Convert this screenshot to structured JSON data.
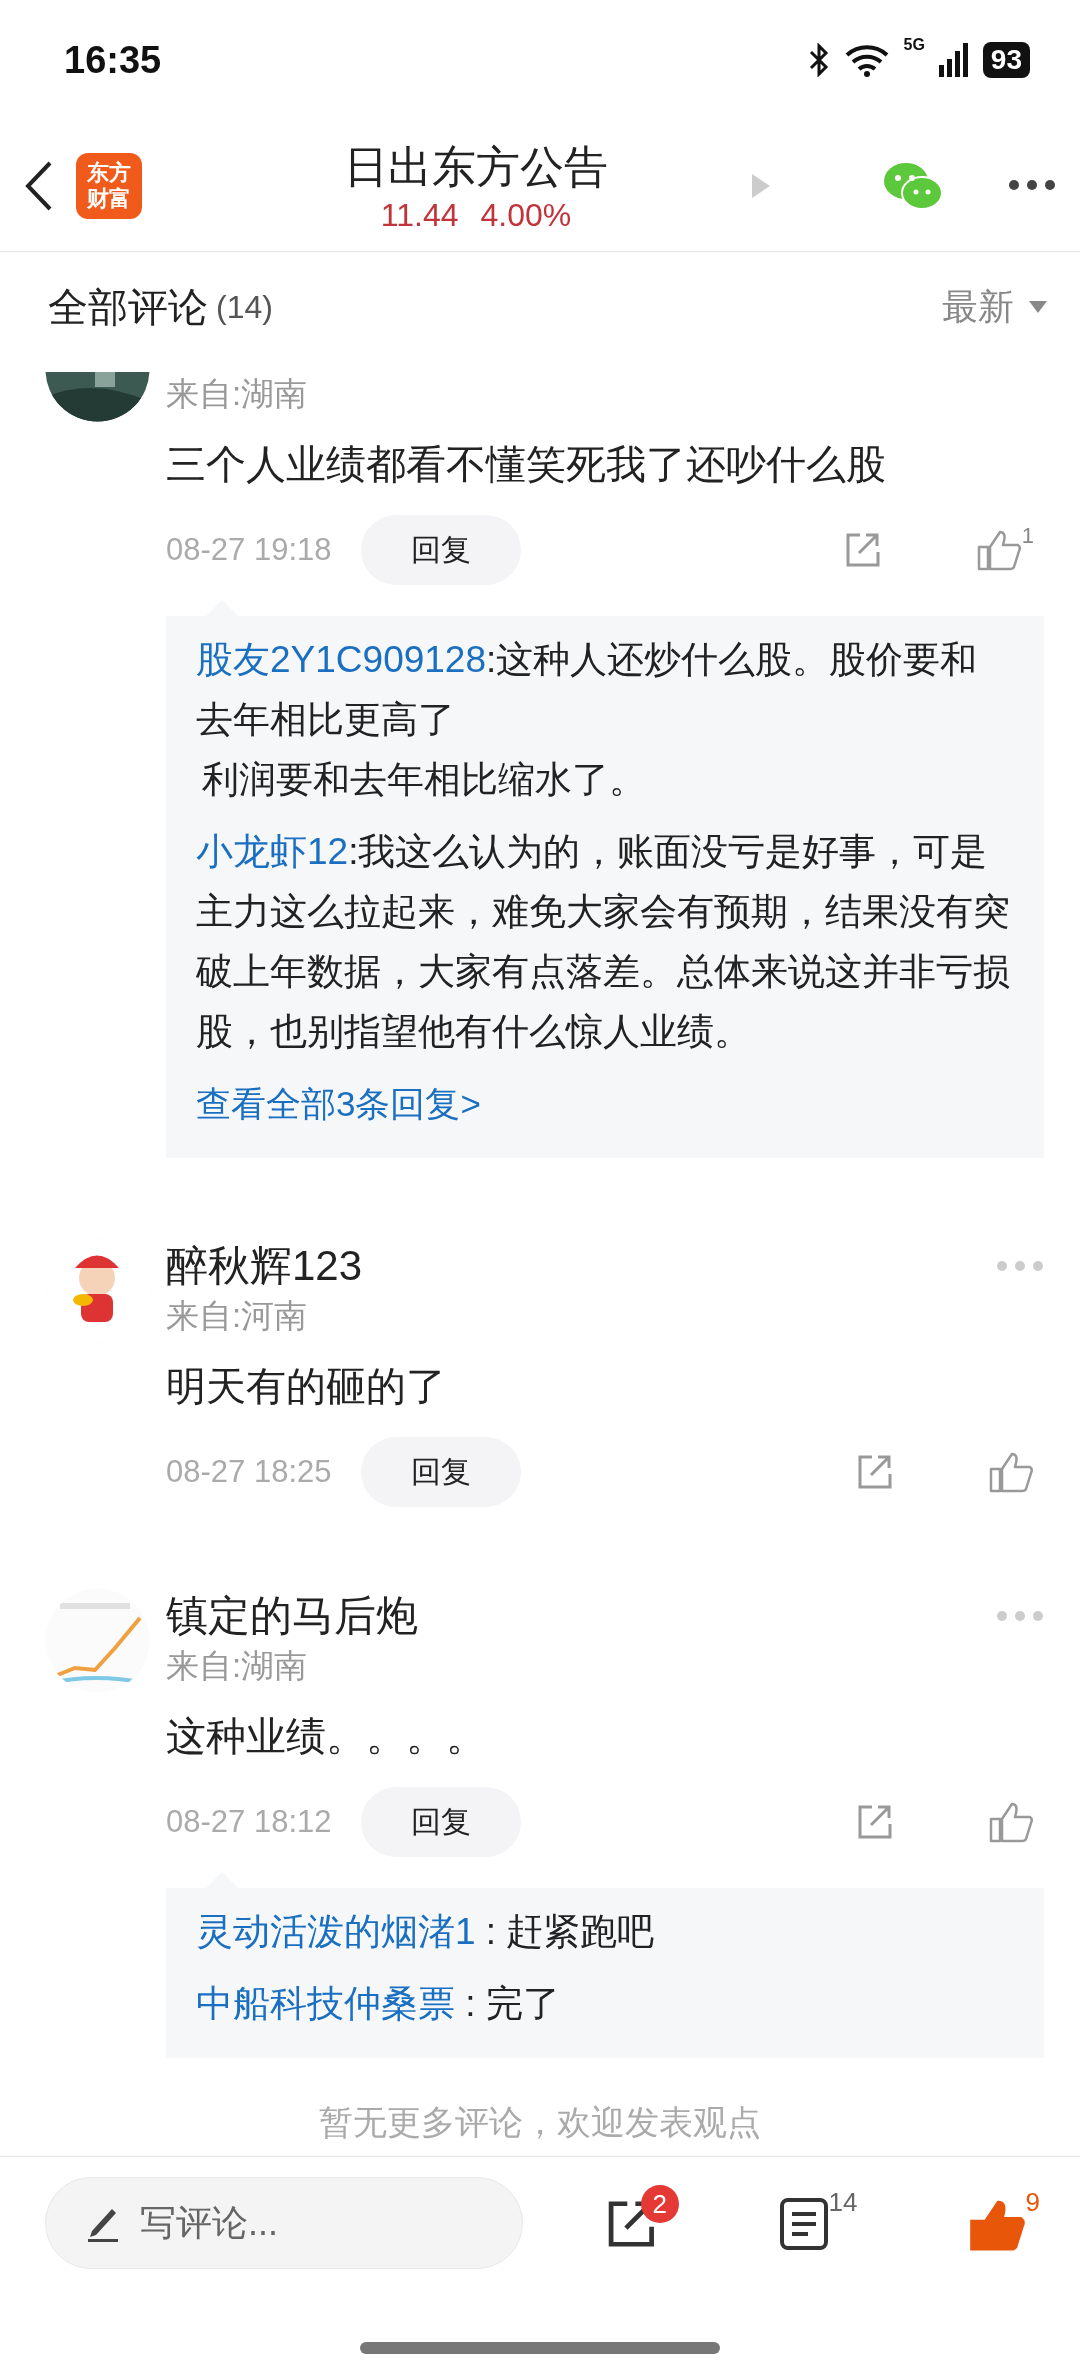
{
  "status_bar": {
    "time": "16:35",
    "network": "5G",
    "battery": "93"
  },
  "header": {
    "logo_lines": [
      "东方",
      "财富"
    ],
    "title": "日出东方公告",
    "price": "11.44",
    "change": "4.00%"
  },
  "comments_header": {
    "title": "全部评论",
    "count": "(14)",
    "sort": "最新"
  },
  "comments": [
    {
      "location": "来自:湖南",
      "text": "三个人业绩都看不懂笑死我了还吵什么股",
      "time": "08-27 19:18",
      "reply_label": "回复",
      "likes": "1",
      "replies": [
        {
          "user": "股友2Y1C909128",
          "text": ":这种人还炒什么股。股价要和去年相比更高了",
          "continuation": "利润要和去年相比缩水了。"
        },
        {
          "user": "小龙虾12",
          "text": ":我这么认为的，账面没亏是好事，可是主力这么拉起来，难免大家会有预期，结果没有突破上年数据，大家有点落差。总体来说这并非亏损股，也别指望他有什么惊人业绩。"
        }
      ],
      "more_replies": "查看全部3条回复>"
    },
    {
      "name": "醉秋辉123",
      "location": "来自:河南",
      "text": "明天有的砸的了",
      "time": "08-27 18:25",
      "reply_label": "回复"
    },
    {
      "name": "镇定的马后炮",
      "location": "来自:湖南",
      "text": "这种业绩。。。。",
      "time": "08-27 18:12",
      "reply_label": "回复",
      "replies": [
        {
          "user": "灵动活泼的烟渚1",
          "text": " : 赶紧跑吧"
        },
        {
          "user": "中船科技仲桑票",
          "text": " : 完了"
        }
      ]
    }
  ],
  "footer_note": "暂无更多评论，欢迎发表观点",
  "bottom_bar": {
    "placeholder": "写评论...",
    "share_badge": "2",
    "comment_count": "14",
    "like_count": "9",
    "liked": true
  }
}
